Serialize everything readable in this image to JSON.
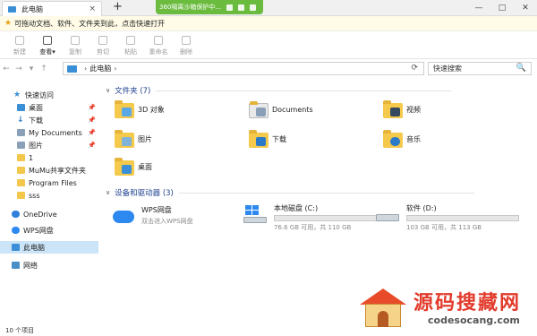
{
  "tab": {
    "label": "此电脑",
    "close": "×",
    "new": "+"
  },
  "sandbox": {
    "label": "360隔离沙箱保护中..."
  },
  "window": {
    "minimize": "—",
    "maximize": "□",
    "close": "✕"
  },
  "infobar": {
    "text": "可拖动文档、软件、文件夹到此，点击快速打开"
  },
  "toolbar": {
    "items": [
      {
        "label": "新建"
      },
      {
        "label": "查看▾"
      },
      {
        "label": "复制"
      },
      {
        "label": "剪切"
      },
      {
        "label": "粘贴"
      },
      {
        "label": "重命名"
      },
      {
        "label": "删除"
      }
    ]
  },
  "nav": {
    "back": "←",
    "forward": "→",
    "dropdown": "▾",
    "up": "↑"
  },
  "address": {
    "chev": "›",
    "location": "此电脑",
    "chev2": "›",
    "refresh": "⟳"
  },
  "search": {
    "placeholder": "快速搜索",
    "icon": "🔍"
  },
  "sidebar": {
    "items": [
      {
        "label": "快速访问"
      },
      {
        "label": "桌面"
      },
      {
        "label": "下载"
      },
      {
        "label": "My Documents"
      },
      {
        "label": "图片"
      },
      {
        "label": "1"
      },
      {
        "label": "MuMu共享文件夹"
      },
      {
        "label": "Program Files"
      },
      {
        "label": "sss"
      },
      {
        "label": "OneDrive"
      },
      {
        "label": "WPS网盘"
      },
      {
        "label": "此电脑"
      },
      {
        "label": "网络"
      }
    ]
  },
  "groups": {
    "folders": {
      "title": "文件夹 (7)"
    },
    "devices": {
      "title": "设备和驱动器 (3)"
    }
  },
  "folders": [
    {
      "name": "3D 对象"
    },
    {
      "name": "Documents"
    },
    {
      "name": "视频"
    },
    {
      "name": "图片"
    },
    {
      "name": "下载"
    },
    {
      "name": "音乐"
    },
    {
      "name": "桌面"
    }
  ],
  "drives": {
    "wps": {
      "name": "WPS网盘",
      "sub": "双击进入WPS网盘"
    },
    "c": {
      "name": "本地磁盘 (C:)",
      "free": "76.6 GB 可用，共 110 GB",
      "used_fraction": 0.3
    },
    "d": {
      "name": "软件 (D:)",
      "free": "103 GB 可用，共 113 GB",
      "used_fraction": 0.09
    }
  },
  "status": {
    "count": "10 个项目"
  },
  "watermark": {
    "title": "源码搜藏网",
    "url": "codesocang.com"
  },
  "colors": {
    "accent": "#3b8fd6",
    "drive_bar": "#26a0da",
    "sandbox": "#6abb3e",
    "group_title": "#1e3f8f"
  }
}
